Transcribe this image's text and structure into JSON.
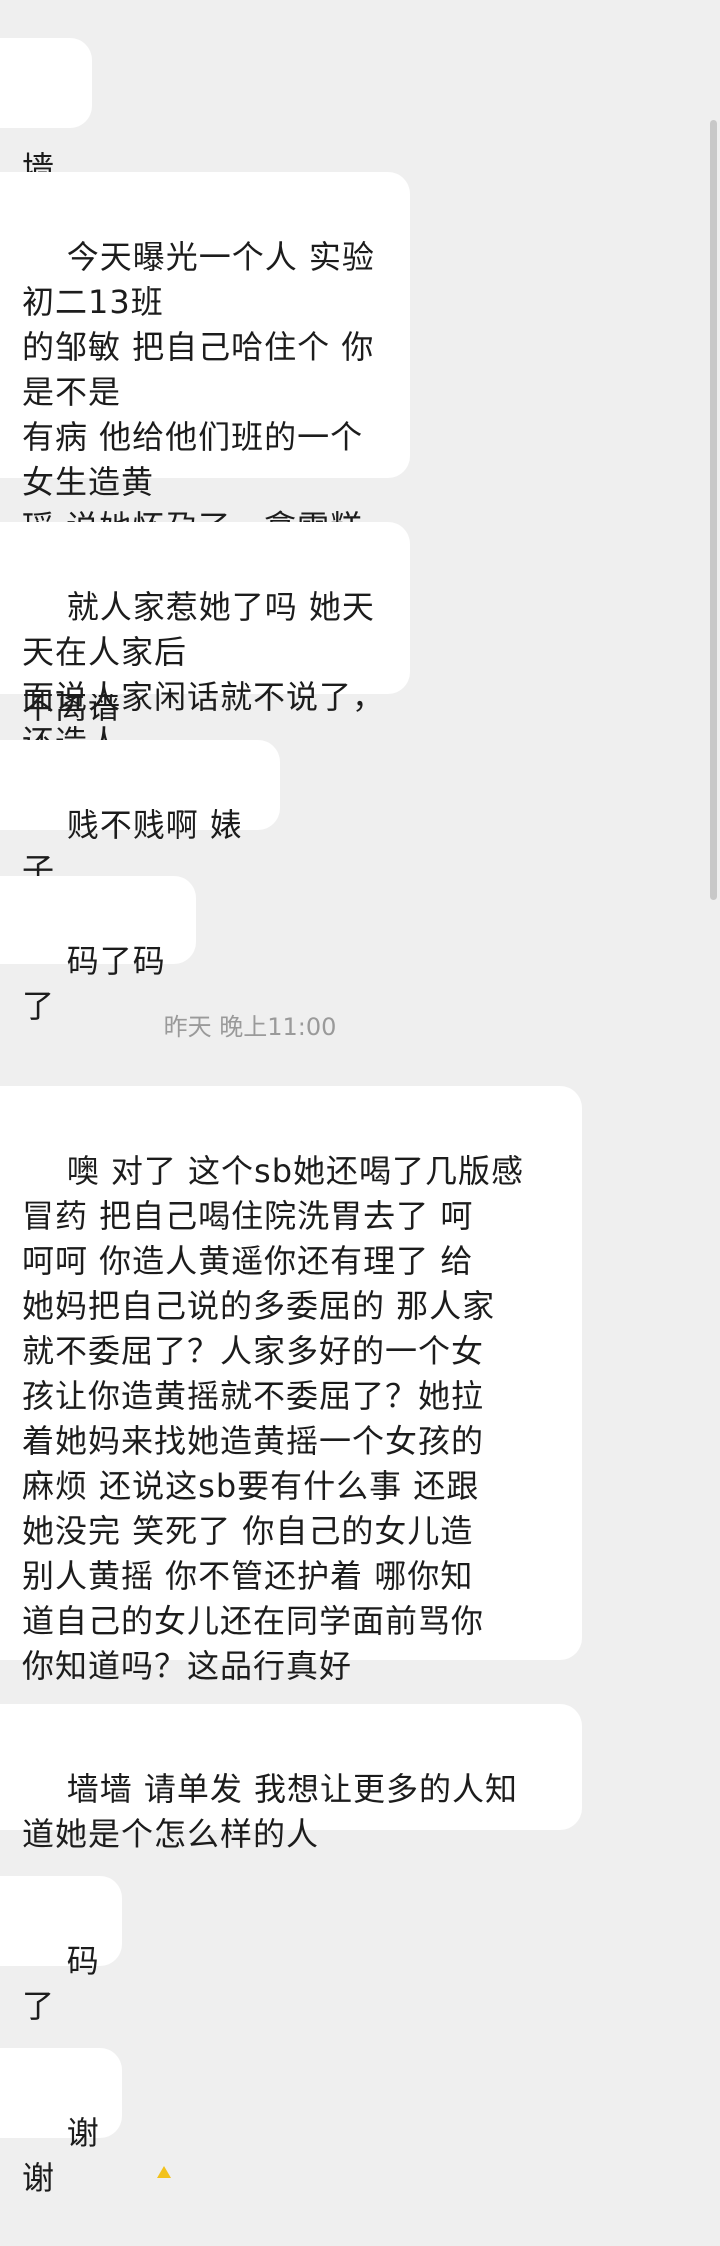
{
  "messages": [
    {
      "text": "墙"
    },
    {
      "text": "今天曝光一个人 实验初二13班\n的邹敏 把自己哈住个 你是不是\n有病 他给他们班的一个女生造黄\n瑶 说她怀孕了，拿雪糕打胎呢\n呵呵呵 你自己看看你自己这话离\n不离谱"
    },
    {
      "text": "就人家惹她了吗 她天天在人家后\n面说人家闲话就不说了，还造人\n家黄瑶"
    },
    {
      "text": "贱不贱啊 婊子"
    },
    {
      "text": "码了码了"
    },
    {
      "text": "噢 对了 这个sb她还喝了几版感\n冒药 把自己喝住院洗胃去了 呵\n呵呵 你造人黄遥你还有理了 给\n她妈把自己说的多委屈的 那人家\n就不委屈了？人家多好的一个女\n孩让你造黄摇就不委屈了？她拉\n着她妈来找她造黄摇一个女孩的\n麻烦 还说这sb要有什么事 还跟\n她没完 笑死了 你自己的女儿造\n别人黄摇 你不管还护着 哪你知\n道自己的女儿还在同学面前骂你\n你知道吗？这品行真好"
    },
    {
      "text": "墙墙 请单发 我想让更多的人知\n道她是个怎么样的人"
    },
    {
      "text": "码了"
    },
    {
      "text": "谢谢"
    }
  ],
  "timestamp": "昨天 晚上11:00",
  "footer": {
    "icon": "warning-icon",
    "text": ""
  },
  "colors": {
    "background": "#efefef",
    "bubble": "#ffffff",
    "text": "#1c1c1c",
    "timestamp": "#9a9a9a",
    "warning": "#f2c21b"
  }
}
